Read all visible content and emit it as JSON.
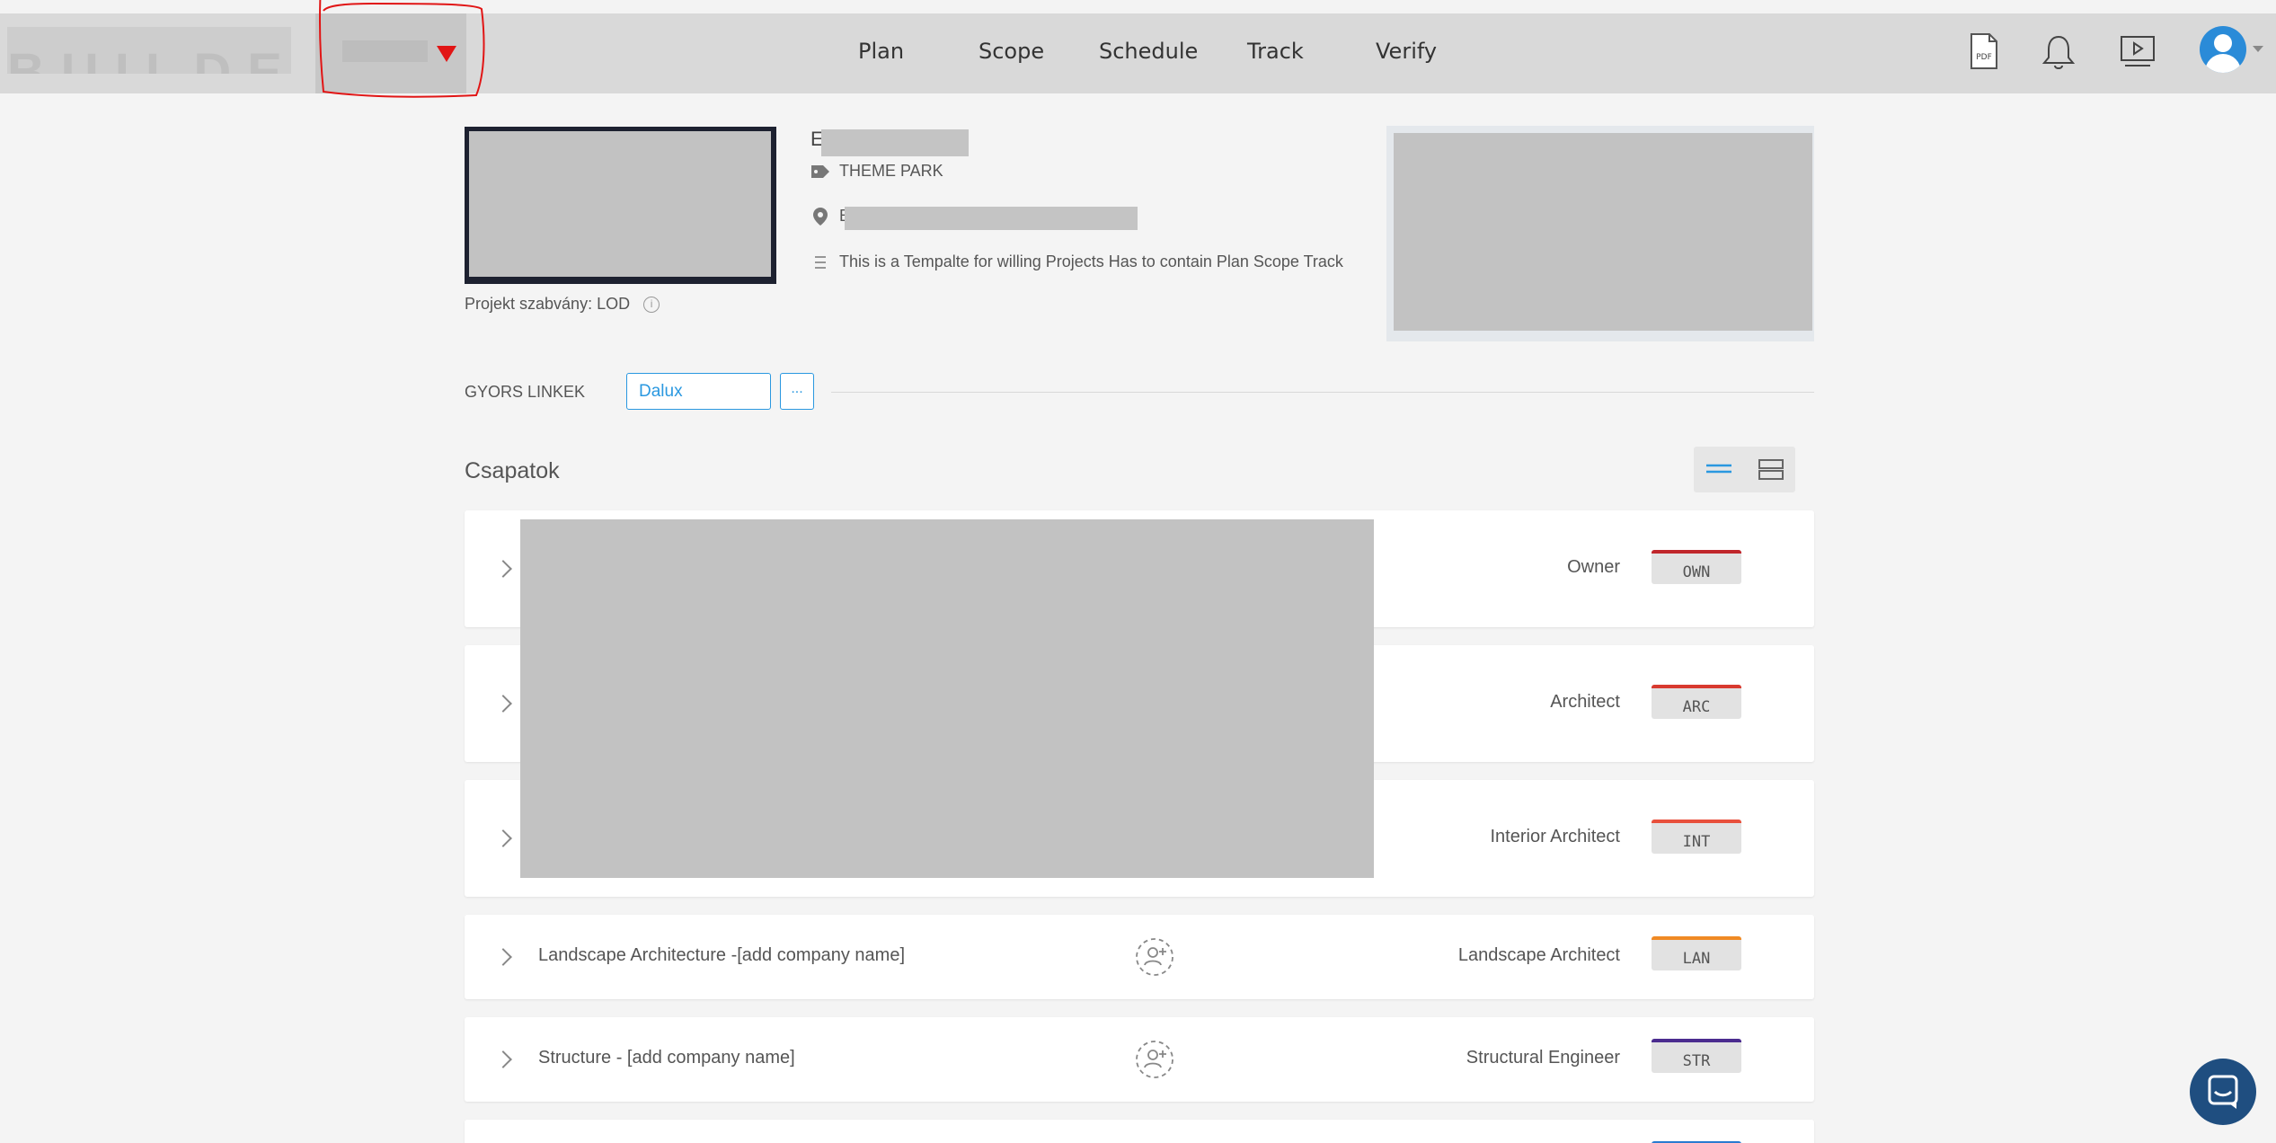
{
  "nav": {
    "logo_text": "BUILDER",
    "links": [
      "Plan",
      "Scope",
      "Schedule",
      "Track",
      "Verify"
    ],
    "icons": [
      "pdf-icon",
      "bell-icon",
      "video-tutorial-icon",
      "user-avatar-icon"
    ],
    "pdf_label": "PDF",
    "annotation_color": "#e11515"
  },
  "project": {
    "name_initial": "E",
    "type": "THEME PARK",
    "address_initial": "E",
    "description": "This is a Tempalte for willing Projects Has to contain Plan Scope Track",
    "standard_label": "Projekt szabvány:",
    "standard_value": "LOD",
    "info_glyph": "i"
  },
  "quick_links": {
    "label": "GYORS LINKEK",
    "items": [
      "Dalux"
    ],
    "more_label": "..."
  },
  "teams": {
    "title": "Csapatok",
    "rows": [
      {
        "name": "",
        "role": "Owner",
        "code": "OWN",
        "color": "#c0262b"
      },
      {
        "name": "",
        "role": "Architect",
        "code": "ARC",
        "color": "#d83a2f"
      },
      {
        "name": "",
        "role": "Interior Architect",
        "code": "INT",
        "color": "#e8503c"
      },
      {
        "name": "Landscape Architecture -[add company name]",
        "role": "Landscape Architect",
        "code": "LAN",
        "color": "#f08a24"
      },
      {
        "name": "Structure - [add company name]",
        "role": "Structural Engineer",
        "code": "STR",
        "color": "#4b2c8f"
      }
    ]
  }
}
